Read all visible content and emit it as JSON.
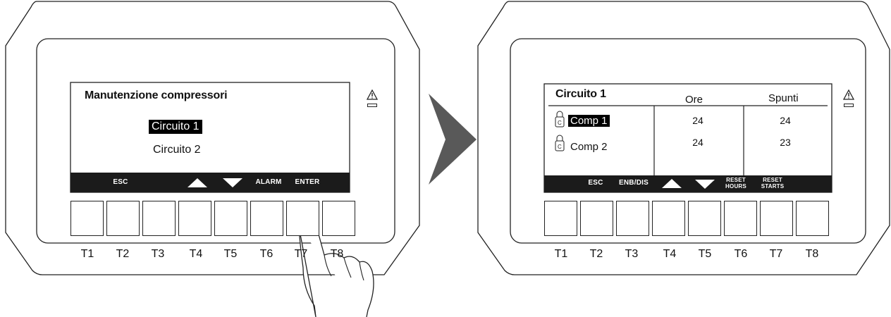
{
  "panel_left": {
    "title": "Manutenzione compressori",
    "menu": [
      {
        "label": "Circuito 1",
        "selected": true
      },
      {
        "label": "Circuito 2",
        "selected": false
      }
    ],
    "softkeys": [
      "ESC",
      "ALARM",
      "ENTER"
    ],
    "softkey_icons": [
      "arrow-up-icon",
      "arrow-down-icon"
    ],
    "keys": [
      "T1",
      "T2",
      "T3",
      "T4",
      "T5",
      "T6",
      "T7",
      "T8"
    ]
  },
  "panel_right": {
    "title": "Circuito 1",
    "columns": [
      "Ore",
      "Spunti"
    ],
    "rows": [
      {
        "name": "Comp 1",
        "ore": "24",
        "spunti": "24",
        "selected": true
      },
      {
        "name": "Comp 2",
        "ore": "24",
        "spunti": "23",
        "selected": false
      }
    ],
    "softkeys": {
      "esc": "ESC",
      "enb": "ENB/DIS",
      "reset_hours": [
        "RESET",
        "HOURS"
      ],
      "reset_starts": [
        "RESET",
        "STARTS"
      ]
    },
    "softkey_icons": [
      "arrow-up-icon",
      "arrow-down-icon"
    ],
    "row_icon": "compressor-icon",
    "keys": [
      "T1",
      "T2",
      "T3",
      "T4",
      "T5",
      "T6",
      "T7",
      "T8"
    ]
  },
  "alarm_icon": "warning-icon",
  "transition_icon": "arrow-right-icon",
  "hand_icon": "finger-press-icon"
}
